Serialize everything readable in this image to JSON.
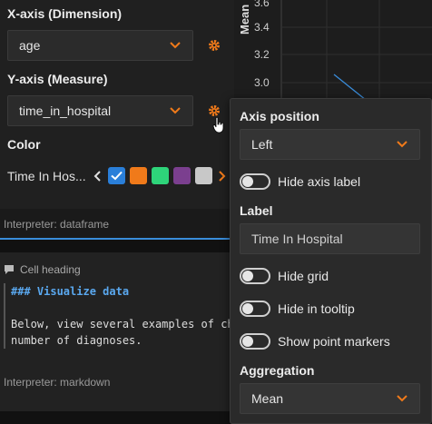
{
  "left_panel": {
    "x_axis_label": "X-axis (Dimension)",
    "x_axis_value": "age",
    "y_axis_label": "Y-axis (Measure)",
    "y_axis_value": "time_in_hospital",
    "color_label": "Color",
    "color_series": "Time In Hos...",
    "swatches": [
      "#2a7fd9",
      "#f07a1a",
      "#2ed47a",
      "#7b3f8f",
      "#c8c8c8"
    ],
    "interpreter": "Interpreter: dataframe"
  },
  "chart": {
    "y_label": "Mean",
    "ticks": [
      "3.6",
      "3.4",
      "3.2",
      "3.0"
    ],
    "line_color": "#3a8ddb"
  },
  "cell": {
    "heading": "Cell heading",
    "code_heading": "### Visualize data",
    "code_line1": "Below, view several examples of ch",
    "code_line2": "number of diagnoses.",
    "interpreter": "Interpreter: markdown"
  },
  "popup": {
    "axis_position_label": "Axis position",
    "axis_position_value": "Left",
    "hide_axis_label": "Hide axis label",
    "label_label": "Label",
    "label_value": "Time In Hospital",
    "hide_grid": "Hide grid",
    "hide_tooltip": "Hide in tooltip",
    "show_markers": "Show point markers",
    "aggregation_label": "Aggregation",
    "aggregation_value": "Mean"
  },
  "accent_color": "#f07a1a"
}
